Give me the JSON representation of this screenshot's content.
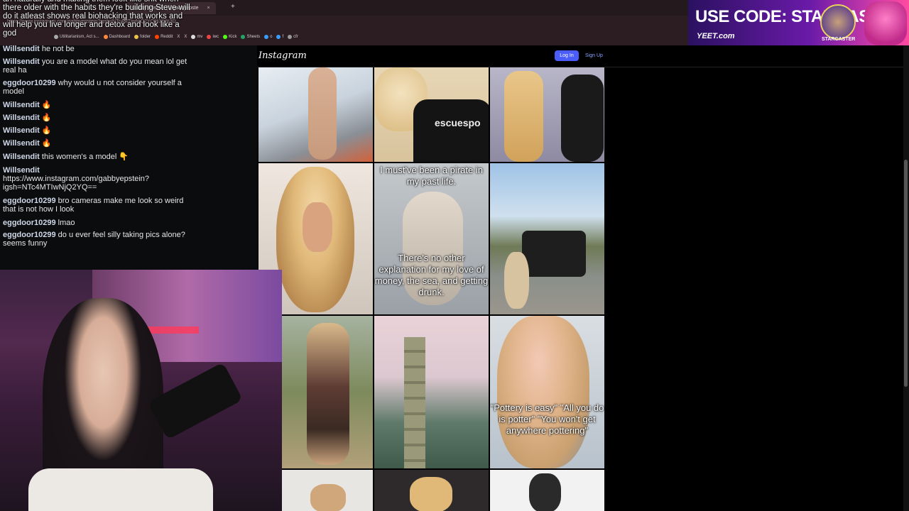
{
  "browser": {
    "tab_title": "Gabby Epstein (@gabbyepste",
    "tab_close": "×",
    "new_tab": "+",
    "url": "https://www.instagram.com/gabbyepstein?igsh=NTc4MTIwNjQ2YQ%3D%3D",
    "bookmarks": [
      "Utilitarianism, Act s...",
      "Dashboard",
      "folder",
      "Reddit",
      "X",
      "X",
      "mv",
      "iwc",
      "Kick",
      "Sheets",
      "o",
      "f",
      "cfr"
    ]
  },
  "overlay_text": "an naturally and making them look like shit when there older with the habits they're building Steve will do it atleast shows real biohacking that works and will help you live longer and detox and look like a god",
  "chat": [
    {
      "user": "Willsendit",
      "text": "he not be"
    },
    {
      "user": "Willsendit",
      "text": "you are a model what do you mean lol get real ha"
    },
    {
      "user": "eggdoor10299",
      "text": "why would u not consider yourself a model"
    },
    {
      "user": "Willsendit",
      "text": "🔥"
    },
    {
      "user": "Willsendit",
      "text": "🔥"
    },
    {
      "user": "Willsendit",
      "text": "🔥"
    },
    {
      "user": "Willsendit",
      "text": "🔥"
    },
    {
      "user": "Willsendit",
      "text": "this women's a model 👇"
    },
    {
      "user": "Willsendit",
      "text": "https://www.instagram.com/gabbyepstein?igsh=NTc4MTIwNjQ2YQ=="
    },
    {
      "user": "eggdoor10299",
      "text": "bro cameras make me look so weird that is not how I look"
    },
    {
      "user": "eggdoor10299",
      "text": "lmao"
    },
    {
      "user": "eggdoor10299",
      "text": "do u ever feel silly taking pics alone? seems funny"
    }
  ],
  "ad": {
    "code_text": "USE CODE: STARCASTER",
    "brand": "YEET.com",
    "label": "STARCASTER"
  },
  "instagram": {
    "logo": "Instagram",
    "login": "Log In",
    "signup": "Sign Up",
    "captions": {
      "pirate_top": "I must've been a pirate in my past life.",
      "pirate_bottom": "There's no other explanation for my love of money, the sea, and getting drunk.",
      "pottery": "\"Pottery is easy\" \"All you do is potter\" \"You won't get anywhere pottering\"",
      "shirt": "escuespo"
    }
  },
  "colors": {
    "login_button": "#4a5df9",
    "ig_background": "#000000",
    "browser_chrome": "#2b1d22"
  }
}
